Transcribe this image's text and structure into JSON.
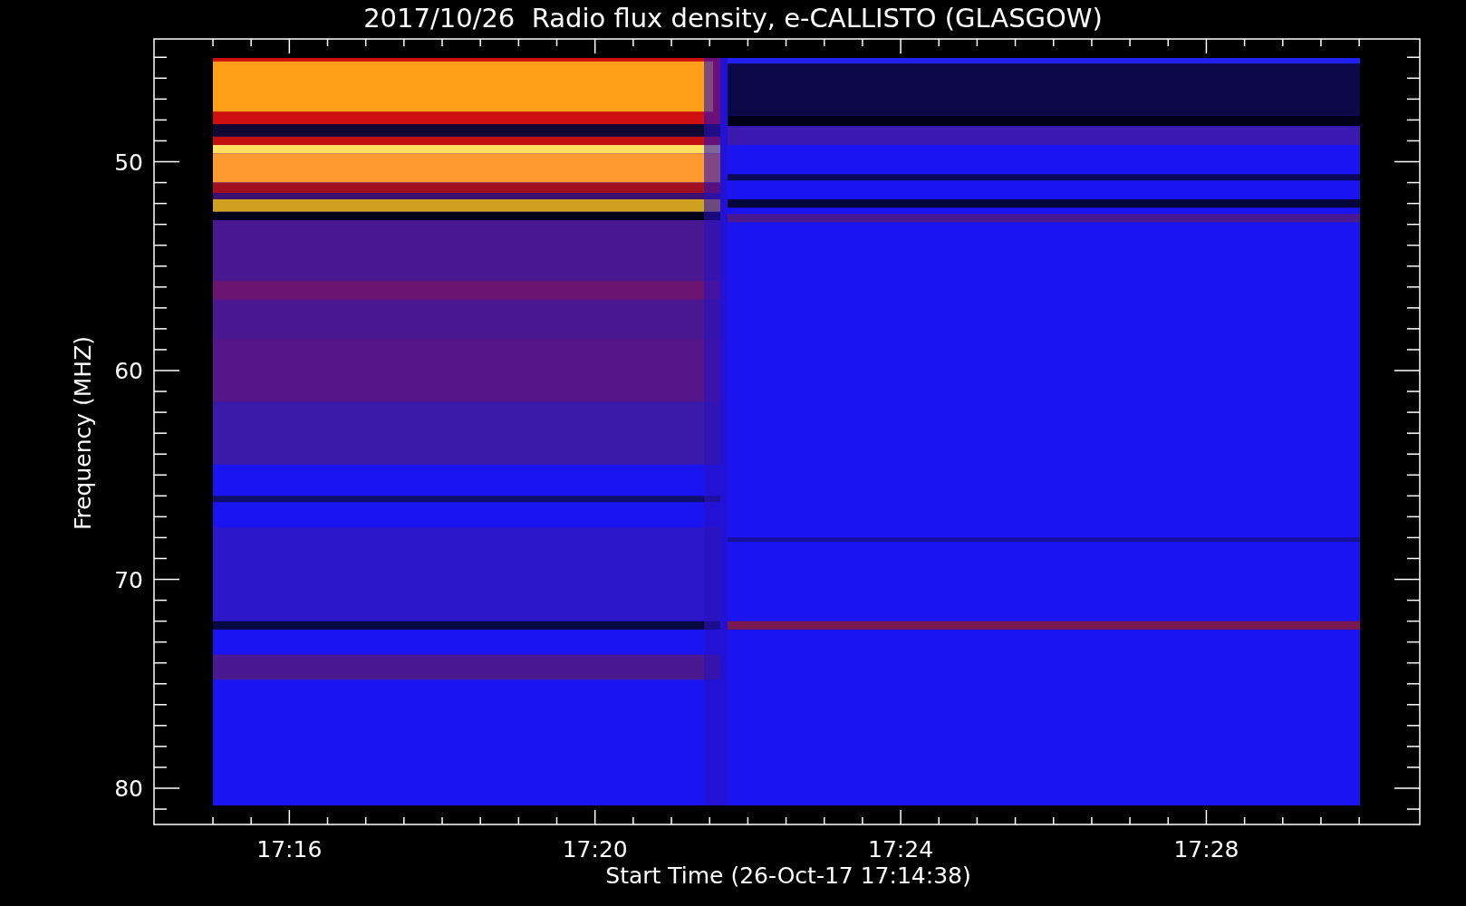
{
  "chart": {
    "title": "2017/10/26  Radio flux density, e-CALLISTO (GLASGOW)",
    "xlabel": "Start Time (26-Oct-17 17:14:38)",
    "ylabel": "Frequency (MHZ)",
    "x_tick_labels": [
      "17:16",
      "17:20",
      "17:24",
      "17:28"
    ],
    "y_tick_labels": [
      "50",
      "60",
      "70",
      "80"
    ]
  }
}
